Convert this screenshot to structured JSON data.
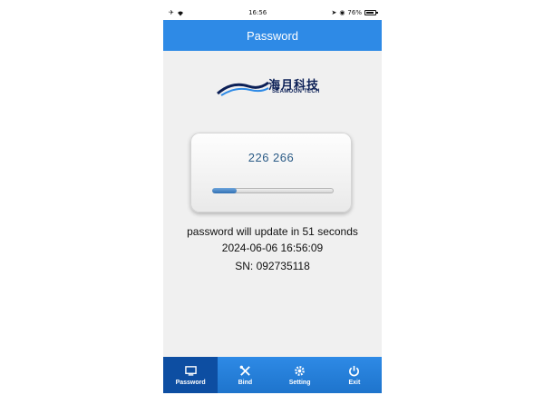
{
  "status_bar": {
    "time": "16:56",
    "battery": "76%"
  },
  "header": {
    "title": "Password"
  },
  "logo": {
    "cn": "海月科技",
    "en": "SEAMOON TECH"
  },
  "otp": {
    "code": "226 266",
    "progress_fraction": 0.2
  },
  "info": {
    "update_text": "password will update in 51 seconds",
    "datetime": "2024-06-06 16:56:09",
    "sn": "SN: 092735118"
  },
  "tabs": [
    {
      "label": "Password",
      "icon": "monitor-icon",
      "active": true
    },
    {
      "label": "Bind",
      "icon": "tools-icon",
      "active": false
    },
    {
      "label": "Setting",
      "icon": "gear-icon",
      "active": false
    },
    {
      "label": "Exit",
      "icon": "power-icon",
      "active": false
    }
  ],
  "colors": {
    "accent": "#2e8ae6",
    "active_tab": "#0d4ea2",
    "code_text": "#2b5b86"
  }
}
